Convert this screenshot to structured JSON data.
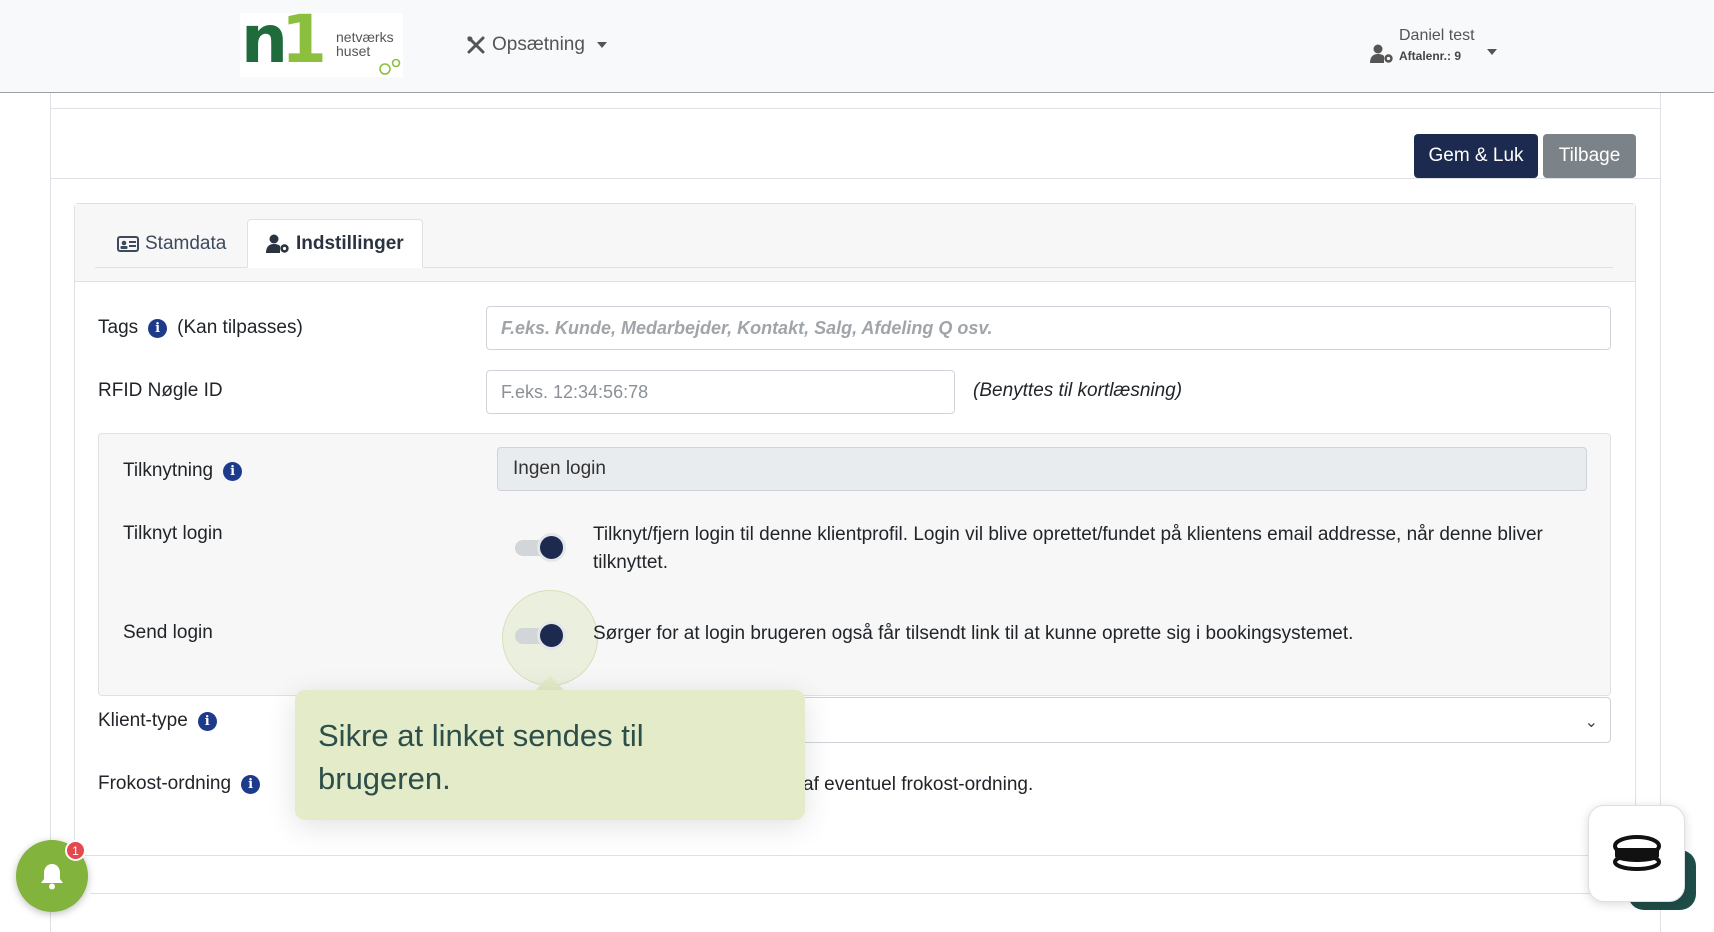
{
  "header": {
    "logo": {
      "mark": "n1",
      "text_line1": "netværks",
      "text_line2": "huset"
    },
    "menu_label": "Opsætning",
    "user": {
      "name": "Daniel test",
      "agreement_label": "Aftalenr.:",
      "agreement_number": "9"
    }
  },
  "toolbar": {
    "save_close_label": "Gem & Luk",
    "back_label": "Tilbage"
  },
  "tabs": [
    {
      "label": "Stamdata",
      "icon": "id-card-icon",
      "active": false
    },
    {
      "label": "Indstillinger",
      "icon": "user-gear-icon",
      "active": true
    }
  ],
  "form": {
    "tags": {
      "label": "Tags",
      "hint": "(Kan tilpasses)",
      "placeholder": "F.eks. Kunde, Medarbejder, Kontakt, Salg, Afdeling Q osv."
    },
    "rfid": {
      "label": "RFID Nøgle ID",
      "placeholder": "F.eks. 12:34:56:78",
      "note": "(Benyttes til kortlæsning)"
    },
    "connection": {
      "label": "Tilknytning",
      "value": "Ingen login"
    },
    "connect_login": {
      "label": "Tilknyt login",
      "enabled": true,
      "description": "Tilknyt/fjern login til denne klientprofil. Login vil blive oprettet/fundet på klientens email addresse, når denne bliver tilknyttet."
    },
    "send_login": {
      "label": "Send login",
      "enabled": true,
      "description": "Sørger for at login brugeren også får tilsendt link til at kunne oprette sig i bookingsystemet."
    },
    "client_type": {
      "label": "Klient-type",
      "value": ""
    },
    "breakfast": {
      "label": "Frokost-ordning",
      "description_visible": "af eventuel frokost-ordning."
    }
  },
  "tooltip": {
    "text": "Sikre at linket sendes til brugeren."
  },
  "notifications": {
    "count": "1"
  },
  "colors": {
    "primary": "#1b2a4e",
    "secondary": "#7b8288",
    "tooltip_bg": "#e3ebc9",
    "bell_bg": "#82b33d",
    "badge": "#e5484d",
    "info_icon": "#1e3a8a"
  }
}
